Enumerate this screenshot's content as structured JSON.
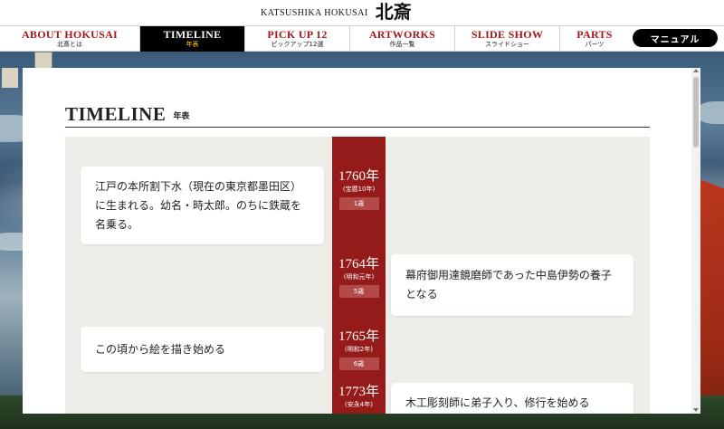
{
  "brand": {
    "en": "KATSUSHIKA HOKUSAI",
    "jp": "北斎"
  },
  "nav": [
    {
      "en": "ABOUT HOKUSAI",
      "jp": "北斎とは"
    },
    {
      "en": "TIMELINE",
      "jp": "年表"
    },
    {
      "en": "PICK UP 12",
      "jp": "ピックアップ12選"
    },
    {
      "en": "ARTWORKS",
      "jp": "作品一覧"
    },
    {
      "en": "SLIDE SHOW",
      "jp": "スライドショー"
    },
    {
      "en": "PARTS",
      "jp": "パーツ"
    }
  ],
  "manual_label": "マニュアル",
  "page": {
    "title_en": "TIMELINE",
    "title_jp": "年表"
  },
  "timeline": [
    {
      "year": "1760年",
      "era": "(宝暦10年)",
      "age": "1歳",
      "side": "left",
      "text": "江戸の本所割下水（現在の東京都墨田区）に生まれる。幼名・時太郎。のちに鉄蔵を名乗る。"
    },
    {
      "year": "1764年",
      "era": "(明和元年)",
      "age": "5歳",
      "side": "right",
      "text": "幕府御用達鏡磨師であった中島伊勢の養子となる"
    },
    {
      "year": "1765年",
      "era": "(明和2年)",
      "age": "6歳",
      "side": "left",
      "text": "この頃から絵を描き始める"
    },
    {
      "year": "1773年",
      "era": "(安永4年)",
      "age": "",
      "side": "right",
      "text": "木工彫刻師に弟子入り、修行を始める"
    }
  ]
}
